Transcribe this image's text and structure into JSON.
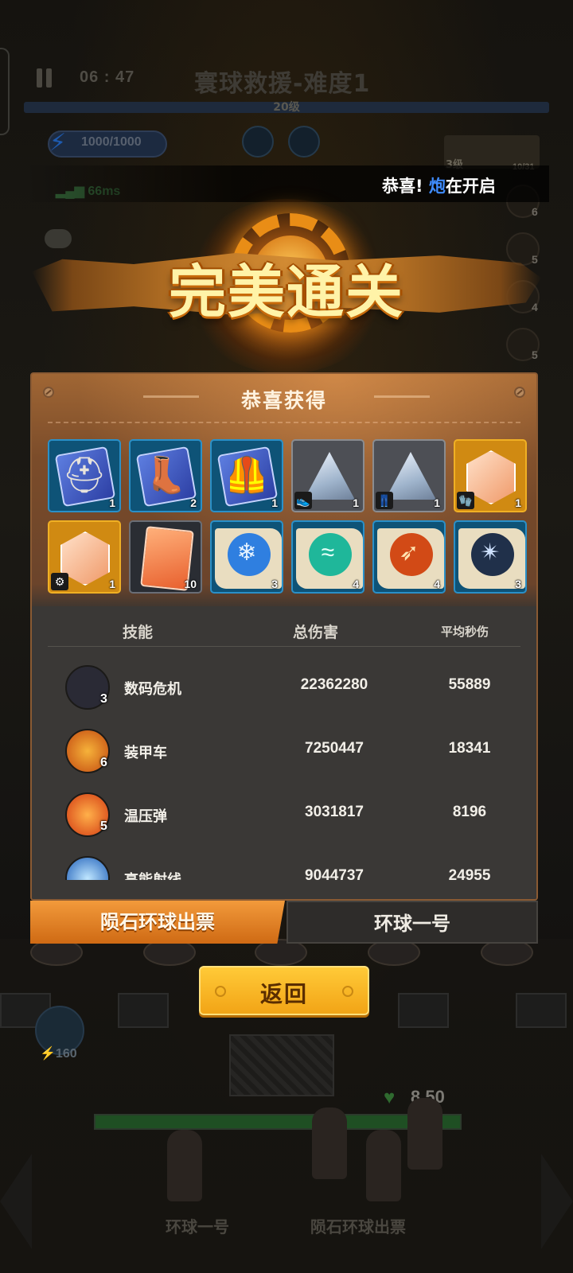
{
  "hud": {
    "timer": "06 : 47",
    "stage_title": "寰球救援-难度1",
    "level_label": "20级",
    "energy": "1000/1000",
    "ping": "66ms",
    "weapon_level": "3级",
    "weapon_count": "10/31",
    "side_counts": [
      "6",
      "5",
      "4",
      "5"
    ]
  },
  "broadcast": {
    "prefix": "恭喜!",
    "highlight": "炮",
    "suffix": "在开启"
  },
  "victory_title": "完美通关",
  "rewards": {
    "title": "恭喜获得",
    "items": [
      {
        "kind": "blue",
        "icon": "helmet-card-icon",
        "glyph": "⛑",
        "count": "1"
      },
      {
        "kind": "blue",
        "icon": "boots-card-icon",
        "glyph": "👢",
        "count": "2"
      },
      {
        "kind": "blue",
        "icon": "armor-card-icon",
        "glyph": "🦺",
        "count": "1"
      },
      {
        "kind": "gray",
        "icon": "shoe-shard-icon",
        "glyph": "",
        "count": "1",
        "tag": "👟"
      },
      {
        "kind": "gray",
        "icon": "pants-shard-icon",
        "glyph": "",
        "count": "1",
        "tag": "👖"
      },
      {
        "kind": "gold",
        "icon": "glove-crystal-icon",
        "glyph": "",
        "count": "1",
        "tag": "🧤"
      },
      {
        "kind": "gold",
        "icon": "belt-crystal-icon",
        "glyph": "",
        "count": "1",
        "tag": "⚙"
      },
      {
        "kind": "blue",
        "icon": "weapon-blueprint-icon",
        "glyph": "",
        "count": "10"
      },
      {
        "kind": "blue",
        "icon": "ice-burst-scroll-icon",
        "glyph": "❄",
        "count": "3",
        "orb": "#2f7fe0"
      },
      {
        "kind": "blue",
        "icon": "wind-slash-scroll-icon",
        "glyph": "≈",
        "count": "4",
        "orb": "#1fb79a"
      },
      {
        "kind": "blue",
        "icon": "fire-arrow-scroll-icon",
        "glyph": "➶",
        "count": "4",
        "orb": "#d24a16"
      },
      {
        "kind": "blue",
        "icon": "shuriken-scroll-icon",
        "glyph": "✴",
        "count": "3",
        "orb": "#20304a"
      }
    ]
  },
  "stats": {
    "col_skill": "技能",
    "col_total": "总伤害",
    "col_dps": "平均秒伤",
    "rows": [
      {
        "name": "数码危机",
        "level": "3",
        "total": "22362280",
        "dps": "55889",
        "icon": "rifle-icon",
        "color": "#2a2a35",
        "glyph": "🔫"
      },
      {
        "name": "装甲车",
        "level": "6",
        "total": "7250447",
        "dps": "18341",
        "icon": "armored-car-icon",
        "color": "#d9641c",
        "glyph": "☣"
      },
      {
        "name": "温压弹",
        "level": "5",
        "total": "3031817",
        "dps": "8196",
        "icon": "thermobaric-shell-icon",
        "color": "#e0481a",
        "glyph": "💥"
      },
      {
        "name": "高能射线",
        "level": "",
        "total": "9044737",
        "dps": "24955",
        "icon": "energy-beam-icon",
        "color": "#1f5fb8",
        "glyph": "⚡"
      }
    ]
  },
  "tabs": {
    "active": "陨石环球出票",
    "inactive": "环球一号"
  },
  "back_label": "返回",
  "battlefield": {
    "ability_cost": "160",
    "hp": "8 50",
    "hero_left": "环球一号",
    "hero_right": "陨石环球出票"
  }
}
